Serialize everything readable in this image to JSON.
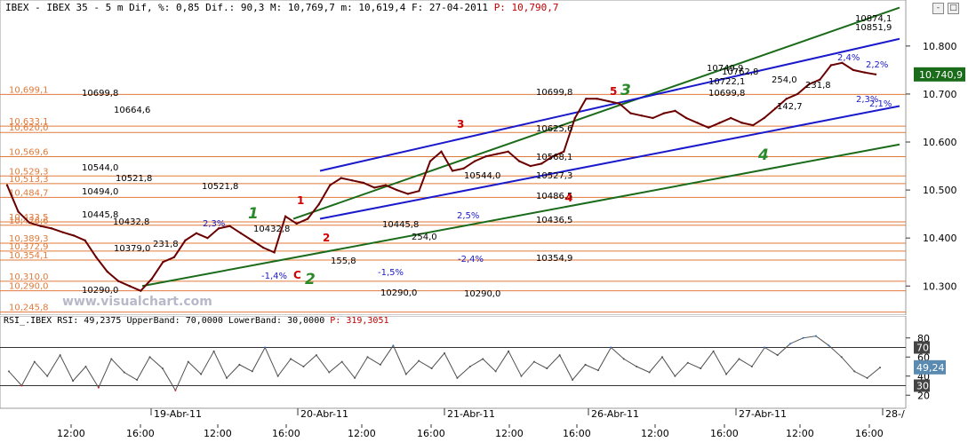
{
  "header": {
    "symbol": "IBEX - IBEX 35 - 5 m Dif, %: 0,85 Dif.: 90,3 M: 10,769,7 m: 10,619,4 F: 27-04-2011",
    "last": "P: 10,790,7"
  },
  "watermark": "www.visualchart.com",
  "rsi_header": {
    "text": "RSI_.IBEX RSI: 49,2375 UpperBand: 70,0000 LowerBand: 30,0000",
    "last": "P: 319,3051"
  },
  "window_buttons": [
    "-",
    "□"
  ],
  "colors": {
    "price": "#6b0000",
    "channel_green": "#1a6b1a",
    "channel_blue": "#1a1acc",
    "level_line": "#e07a3a",
    "wave_red": "#d00000",
    "wave_green": "#2a8a2a",
    "rsi_line": "#505050",
    "rsi_up": "#2a6acc",
    "rsi_down": "#cc2222",
    "last_price_bg": "#1a6b1a"
  },
  "chart_data": [
    {
      "type": "line",
      "name": "IBEX 35 price (5 min)",
      "x_ticks": [
        "12:00",
        "16:00",
        "12:00",
        "16:00",
        "12:00",
        "16:00",
        "12:00",
        "16:00",
        "12:00",
        "16:00",
        "12:00",
        "16:00"
      ],
      "day_labels": [
        "19-Abr-11",
        "20-Abr-11",
        "21-Abr-11",
        "26-Abr-11",
        "27-Abr-11",
        "28-/"
      ],
      "y_ticks": [
        "10.800",
        "10.700",
        "10.600",
        "10.500",
        "10.400",
        "10.300"
      ],
      "ylim": [
        10245,
        10870
      ],
      "last_price": "10.740,9",
      "series": [
        {
          "values": [
            10510,
            10455,
            10432,
            10425,
            10420,
            10412,
            10405,
            10395,
            10360,
            10330,
            10310,
            10300,
            10290,
            10315,
            10350,
            10360,
            10395,
            10410,
            10400,
            10420,
            10425,
            10410,
            10395,
            10380,
            10370,
            10445,
            10430,
            10440,
            10470,
            10510,
            10525,
            10520,
            10515,
            10505,
            10510,
            10500,
            10492,
            10498,
            10560,
            10580,
            10540,
            10545,
            10560,
            10570,
            10575,
            10580,
            10560,
            10550,
            10555,
            10570,
            10580,
            10650,
            10690,
            10690,
            10685,
            10680,
            10660,
            10655,
            10650,
            10660,
            10665,
            10650,
            10640,
            10630,
            10640,
            10650,
            10640,
            10635,
            10650,
            10670,
            10690,
            10700,
            10720,
            10730,
            10760,
            10765,
            10750,
            10745,
            10741
          ]
        }
      ],
      "horizontal_levels": [
        {
          "price": "10,699,1",
          "value": 10699.1
        },
        {
          "price": "10,633,1",
          "value": 10633.1
        },
        {
          "price": "10,620,0",
          "value": 10620.0
        },
        {
          "price": "10,569,6",
          "value": 10569.6
        },
        {
          "price": "10,529,3",
          "value": 10529.3
        },
        {
          "price": "10,513,3",
          "value": 10513.3
        },
        {
          "price": "10,484,7",
          "value": 10484.7
        },
        {
          "price": "10,433,5",
          "value": 10433.5
        },
        {
          "price": "10,426,6",
          "value": 10426.6
        },
        {
          "price": "10,389,3",
          "value": 10389.3
        },
        {
          "price": "10,372,9",
          "value": 10372.9
        },
        {
          "price": "10,354,1",
          "value": 10354.1
        },
        {
          "price": "10,310,0",
          "value": 10310.0
        },
        {
          "price": "10,290,0",
          "value": 10290.0
        },
        {
          "price": "10,245,8",
          "value": 10245.8
        }
      ],
      "price_annotations": [
        "10699,8",
        "10664,6",
        "10544,0",
        "10521,8",
        "10494,0",
        "10445,8",
        "10432,8",
        "10379,0",
        "10290,0",
        "231,8",
        "10521,8",
        "2,3%",
        "10432,8",
        "10445,8",
        "254,0",
        "155,8",
        "-1,4%",
        "-1,5%",
        "10290,0",
        "10544,0",
        "2,5%",
        "-2,4%",
        "10290,0",
        "10699,8",
        "10625,6",
        "10568,1",
        "10527,3",
        "10486,5",
        "10436,5",
        "10354,9",
        "10749,9",
        "10722,1",
        "10699,8",
        "10762,8",
        "254,0",
        "231,8",
        "142,7",
        "10874,1",
        "10851,9",
        "2,4%",
        "2,2%",
        "2,3%",
        "2,1%"
      ],
      "wave_labels": [
        {
          "label": "1",
          "color": "red"
        },
        {
          "label": "2",
          "color": "red"
        },
        {
          "label": "3",
          "color": "red"
        },
        {
          "label": "4",
          "color": "red"
        },
        {
          "label": "5",
          "color": "red"
        },
        {
          "label": "C",
          "color": "red"
        },
        {
          "label": "1",
          "color": "green"
        },
        {
          "label": "2",
          "color": "green"
        },
        {
          "label": "3",
          "color": "green"
        },
        {
          "label": "4",
          "color": "green"
        }
      ]
    },
    {
      "type": "line",
      "name": "RSI",
      "y_ticks": [
        "80",
        "60",
        "40",
        "20"
      ],
      "bands": [
        {
          "label": "70",
          "value": 70
        },
        {
          "label": "30",
          "value": 30
        }
      ],
      "last_value": "49,24",
      "ylim": [
        10,
        90
      ],
      "series": [
        {
          "values": [
            45,
            30,
            55,
            40,
            62,
            35,
            50,
            28,
            58,
            44,
            36,
            60,
            48,
            25,
            55,
            42,
            66,
            38,
            52,
            45,
            70,
            40,
            58,
            50,
            62,
            44,
            55,
            38,
            60,
            52,
            72,
            42,
            56,
            48,
            64,
            38,
            50,
            58,
            45,
            66,
            40,
            55,
            48,
            62,
            36,
            52,
            46,
            70,
            58,
            50,
            44,
            60,
            40,
            54,
            48,
            66,
            42,
            58,
            50,
            70,
            62,
            74,
            80,
            82,
            72,
            60,
            45,
            38,
            49
          ]
        }
      ]
    }
  ]
}
